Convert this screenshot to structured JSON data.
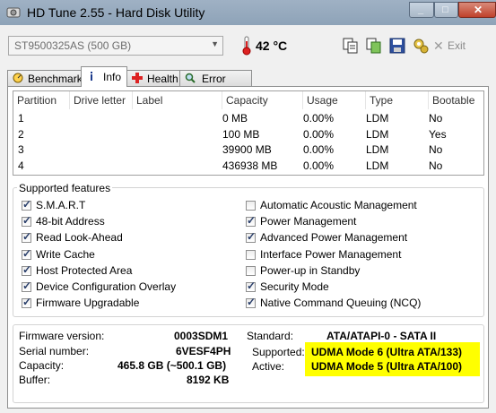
{
  "window": {
    "title": "HD Tune 2.55 - Hard Disk Utility"
  },
  "toolbar": {
    "drive": "ST9500325AS (500 GB)",
    "temperature": "42 °C",
    "exit_label": "Exit",
    "icons": [
      "copy-info-icon",
      "copy-screen-icon",
      "save-icon",
      "options-icon",
      "exit-icon"
    ]
  },
  "tabs": [
    {
      "label": "Benchmark",
      "icon": "benchmark-icon"
    },
    {
      "label": "Info",
      "icon": "info-icon",
      "active": true
    },
    {
      "label": "Health",
      "icon": "health-icon"
    },
    {
      "label": "Error Scan",
      "icon": "magnifier-icon"
    }
  ],
  "partitions": {
    "columns": [
      "Partition",
      "Drive letter",
      "Label",
      "Capacity",
      "Usage",
      "Type",
      "Bootable"
    ],
    "rows": [
      {
        "partition": "1",
        "drive_letter": "",
        "label": "",
        "capacity": "0 MB",
        "usage": "0.00%",
        "type": "LDM",
        "bootable": "No"
      },
      {
        "partition": "2",
        "drive_letter": "",
        "label": "",
        "capacity": "100 MB",
        "usage": "0.00%",
        "type": "LDM",
        "bootable": "Yes"
      },
      {
        "partition": "3",
        "drive_letter": "",
        "label": "",
        "capacity": "39900 MB",
        "usage": "0.00%",
        "type": "LDM",
        "bootable": "No"
      },
      {
        "partition": "4",
        "drive_letter": "",
        "label": "",
        "capacity": "436938 MB",
        "usage": "0.00%",
        "type": "LDM",
        "bootable": "No"
      }
    ]
  },
  "features": {
    "title": "Supported features",
    "left": [
      {
        "label": "S.M.A.R.T",
        "checked": true
      },
      {
        "label": "48-bit Address",
        "checked": true
      },
      {
        "label": "Read Look-Ahead",
        "checked": true
      },
      {
        "label": "Write Cache",
        "checked": true
      },
      {
        "label": "Host Protected Area",
        "checked": true
      },
      {
        "label": "Device Configuration Overlay",
        "checked": true
      },
      {
        "label": "Firmware Upgradable",
        "checked": true
      }
    ],
    "right": [
      {
        "label": "Automatic Acoustic Management",
        "checked": false
      },
      {
        "label": "Power Management",
        "checked": true
      },
      {
        "label": "Advanced Power Management",
        "checked": true
      },
      {
        "label": "Interface Power Management",
        "checked": false
      },
      {
        "label": "Power-up in Standby",
        "checked": false
      },
      {
        "label": "Security Mode",
        "checked": true
      },
      {
        "label": "Native Command Queuing (NCQ)",
        "checked": true
      }
    ]
  },
  "info": {
    "firmware_label": "Firmware version:",
    "firmware": "0003SDM1",
    "serial_label": "Serial number:",
    "serial": "6VESF4PH",
    "capacity_label": "Capacity:",
    "capacity": "465.8 GB (~500.1 GB)",
    "buffer_label": "Buffer:",
    "buffer": "8192 KB",
    "standard_label": "Standard:",
    "standard": "ATA/ATAPI-0 - SATA II",
    "supported_label": "Supported:",
    "supported": "UDMA Mode 6 (Ultra ATA/133)",
    "active_label": "Active:",
    "active": "UDMA Mode 5 (Ultra ATA/100)",
    "highlight_color": "#ffff00"
  }
}
